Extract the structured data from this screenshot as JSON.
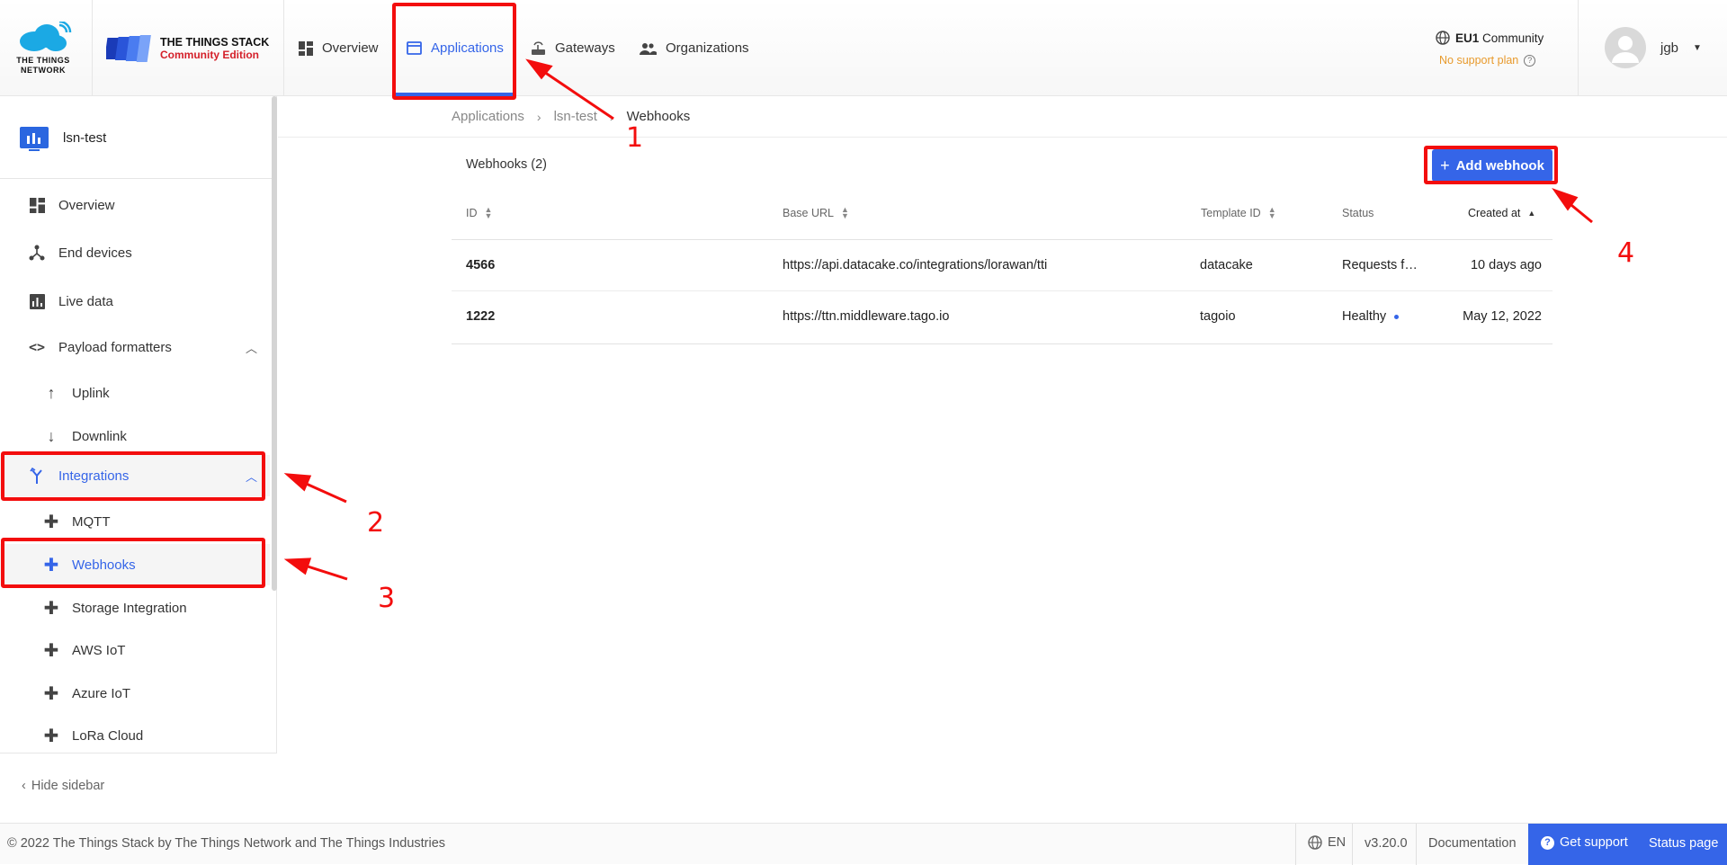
{
  "brand": {
    "ttn_logo_text_line1": "THE THINGS",
    "ttn_logo_text_line2": "NETWORK",
    "stack_title": "THE THINGS STACK",
    "stack_edition": "Community Edition"
  },
  "nav": {
    "items": [
      {
        "label": "Overview",
        "icon": "dashboard-icon"
      },
      {
        "label": "Applications",
        "icon": "application-icon"
      },
      {
        "label": "Gateways",
        "icon": "gateway-icon"
      },
      {
        "label": "Organizations",
        "icon": "organizations-icon"
      }
    ]
  },
  "cluster": {
    "name_bold": "EU1",
    "name_rest": " Community",
    "support": "No support plan"
  },
  "user": {
    "name": "jgb"
  },
  "sidebar": {
    "app_name": "lsn-test",
    "items": [
      {
        "label": "Overview"
      },
      {
        "label": "End devices"
      },
      {
        "label": "Live data"
      },
      {
        "label": "Payload formatters"
      },
      {
        "label": "Uplink"
      },
      {
        "label": "Downlink"
      },
      {
        "label": "Integrations"
      },
      {
        "label": "MQTT"
      },
      {
        "label": "Webhooks"
      },
      {
        "label": "Storage Integration"
      },
      {
        "label": "AWS IoT"
      },
      {
        "label": "Azure IoT"
      },
      {
        "label": "LoRa Cloud"
      }
    ],
    "hide_label": "Hide sidebar"
  },
  "breadcrumb": [
    "Applications",
    "lsn-test",
    "Webhooks"
  ],
  "webhooks": {
    "title": "Webhooks (2)",
    "add_label": "Add webhook",
    "columns": [
      "ID",
      "Base URL",
      "Template ID",
      "Status",
      "Created at"
    ],
    "rows": [
      {
        "id": "4566",
        "base_url": "https://api.datacake.co/integrations/lorawan/tti",
        "template": "datacake",
        "status": "Requests f…",
        "created": "10 days ago"
      },
      {
        "id": "1222",
        "base_url": "https://ttn.middleware.tago.io",
        "template": "tagoio",
        "status": "Healthy",
        "created": "May 12, 2022"
      }
    ]
  },
  "footer": {
    "copyright": "© 2022 The Things Stack by The Things Network and The Things Industries",
    "lang": "EN",
    "version": "v3.20.0",
    "docs": "Documentation",
    "support": "Get support",
    "status": "Status page"
  },
  "annotations": [
    "1",
    "2",
    "3",
    "4"
  ],
  "colors": {
    "accent": "#3565e8",
    "annotation": "#f30d0d",
    "warning": "#e89a2c",
    "healthy_dot": "#3565e8"
  }
}
